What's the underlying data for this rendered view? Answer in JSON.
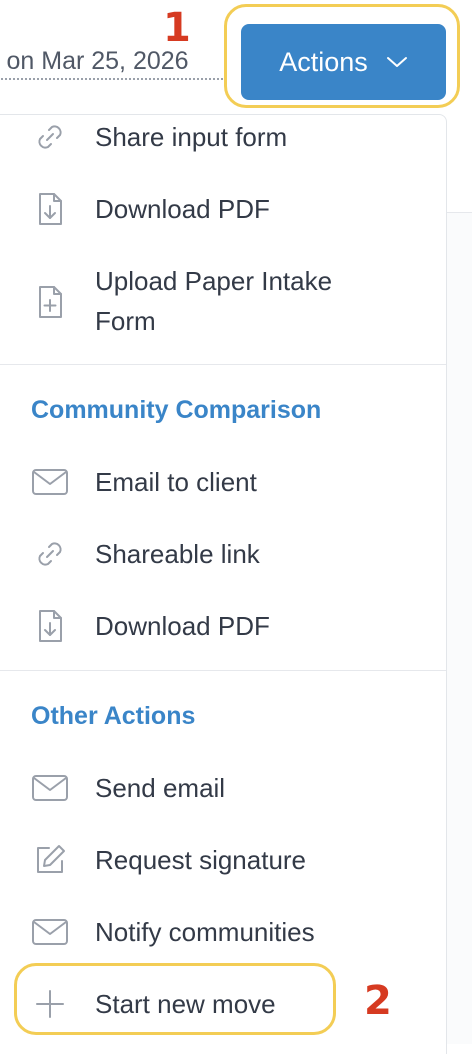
{
  "header": {
    "updated_text": "l on Mar 25, 2026",
    "actions_label": "Actions",
    "step1": "1",
    "step2": "2"
  },
  "menu": {
    "items_top": [
      {
        "label": "Share input form",
        "icon": "link-icon"
      },
      {
        "label": "Download PDF",
        "icon": "file-download-icon"
      },
      {
        "label": "Upload Paper Intake",
        "label2": "Form",
        "icon": "file-plus-icon"
      }
    ],
    "community": {
      "title": "Community Comparison",
      "items": [
        {
          "label": "Email to client",
          "icon": "envelope-icon"
        },
        {
          "label": "Shareable link",
          "icon": "link-icon"
        },
        {
          "label": "Download PDF",
          "icon": "file-download-icon"
        }
      ]
    },
    "other": {
      "title": "Other Actions",
      "items": [
        {
          "label": "Send email",
          "icon": "envelope-icon"
        },
        {
          "label": "Request signature",
          "icon": "pencil-icon"
        },
        {
          "label": "Notify communities",
          "icon": "envelope-icon"
        },
        {
          "label": "Start new move",
          "icon": "plus-icon"
        }
      ]
    }
  },
  "colors": {
    "primary": "#3a85c8",
    "highlight": "#f3cd55",
    "step_number": "#d63a21"
  }
}
